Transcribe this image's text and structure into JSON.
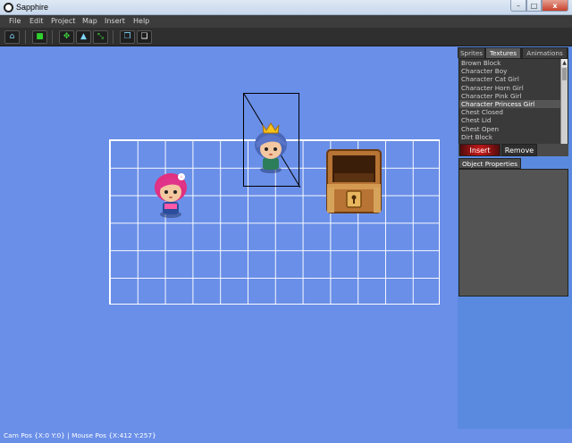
{
  "window": {
    "title": "Sapphire",
    "min": "–",
    "max": "□",
    "close": "x"
  },
  "menu": [
    "File",
    "Edit",
    "Project",
    "Map",
    "Insert",
    "Help"
  ],
  "toolbar": {
    "buttons": [
      "home-icon",
      "folder-icon",
      "move-icon",
      "terrain-icon",
      "fit-icon",
      "layer-back-icon",
      "layer-front-icon"
    ]
  },
  "panel": {
    "tabs": [
      "Sprites",
      "Textures",
      "Animations"
    ],
    "active_tab": "Textures",
    "list_items": [
      "Brown Block",
      "Character Boy",
      "Character Cat Girl",
      "Character Horn Girl",
      "Character Pink Girl",
      "Character Princess Girl",
      "Chest Closed",
      "Chest Lid",
      "Chest Open",
      "Dirt Block"
    ],
    "selected_item": "Character Princess Girl",
    "insert_label": "Insert",
    "remove_label": "Remove",
    "properties_label": "Object Properties"
  },
  "status": {
    "text": "Cam Pos {X:0 Y:0} | Mouse Pos {X:412 Y:257}"
  },
  "colors": {
    "canvas": "#6a8fe8",
    "grid": "#ffffff",
    "accent_red": "#d21b1b"
  }
}
